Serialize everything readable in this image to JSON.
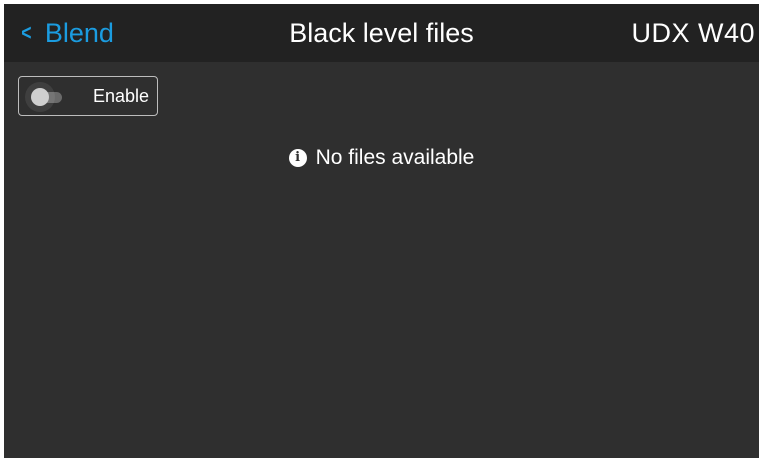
{
  "header": {
    "back_label": "Blend",
    "back_icon": "chevron-left-icon",
    "title": "Black level files",
    "device": "UDX W40"
  },
  "toggle": {
    "label": "Enable",
    "state": "off"
  },
  "empty_state": {
    "icon": "info-icon",
    "icon_glyph": "i",
    "message": "No files available"
  },
  "colors": {
    "accent": "#1b9ce0",
    "header_bg": "#222222",
    "body_bg": "#2f2f2f",
    "text": "#ffffff"
  }
}
